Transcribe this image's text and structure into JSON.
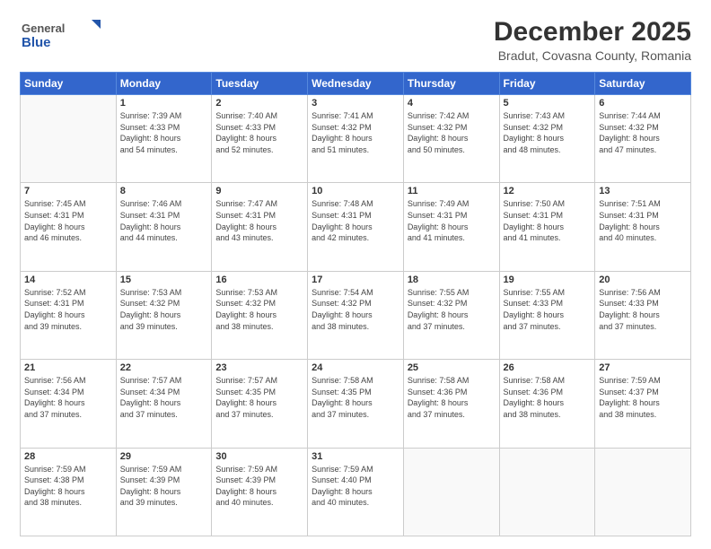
{
  "header": {
    "logo_general": "General",
    "logo_blue": "Blue",
    "title": "December 2025",
    "subtitle": "Bradut, Covasna County, Romania"
  },
  "weekdays": [
    "Sunday",
    "Monday",
    "Tuesday",
    "Wednesday",
    "Thursday",
    "Friday",
    "Saturday"
  ],
  "weeks": [
    [
      {
        "day": "",
        "info": ""
      },
      {
        "day": "1",
        "info": "Sunrise: 7:39 AM\nSunset: 4:33 PM\nDaylight: 8 hours\nand 54 minutes."
      },
      {
        "day": "2",
        "info": "Sunrise: 7:40 AM\nSunset: 4:33 PM\nDaylight: 8 hours\nand 52 minutes."
      },
      {
        "day": "3",
        "info": "Sunrise: 7:41 AM\nSunset: 4:32 PM\nDaylight: 8 hours\nand 51 minutes."
      },
      {
        "day": "4",
        "info": "Sunrise: 7:42 AM\nSunset: 4:32 PM\nDaylight: 8 hours\nand 50 minutes."
      },
      {
        "day": "5",
        "info": "Sunrise: 7:43 AM\nSunset: 4:32 PM\nDaylight: 8 hours\nand 48 minutes."
      },
      {
        "day": "6",
        "info": "Sunrise: 7:44 AM\nSunset: 4:32 PM\nDaylight: 8 hours\nand 47 minutes."
      }
    ],
    [
      {
        "day": "7",
        "info": "Sunrise: 7:45 AM\nSunset: 4:31 PM\nDaylight: 8 hours\nand 46 minutes."
      },
      {
        "day": "8",
        "info": "Sunrise: 7:46 AM\nSunset: 4:31 PM\nDaylight: 8 hours\nand 44 minutes."
      },
      {
        "day": "9",
        "info": "Sunrise: 7:47 AM\nSunset: 4:31 PM\nDaylight: 8 hours\nand 43 minutes."
      },
      {
        "day": "10",
        "info": "Sunrise: 7:48 AM\nSunset: 4:31 PM\nDaylight: 8 hours\nand 42 minutes."
      },
      {
        "day": "11",
        "info": "Sunrise: 7:49 AM\nSunset: 4:31 PM\nDaylight: 8 hours\nand 41 minutes."
      },
      {
        "day": "12",
        "info": "Sunrise: 7:50 AM\nSunset: 4:31 PM\nDaylight: 8 hours\nand 41 minutes."
      },
      {
        "day": "13",
        "info": "Sunrise: 7:51 AM\nSunset: 4:31 PM\nDaylight: 8 hours\nand 40 minutes."
      }
    ],
    [
      {
        "day": "14",
        "info": "Sunrise: 7:52 AM\nSunset: 4:31 PM\nDaylight: 8 hours\nand 39 minutes."
      },
      {
        "day": "15",
        "info": "Sunrise: 7:53 AM\nSunset: 4:32 PM\nDaylight: 8 hours\nand 39 minutes."
      },
      {
        "day": "16",
        "info": "Sunrise: 7:53 AM\nSunset: 4:32 PM\nDaylight: 8 hours\nand 38 minutes."
      },
      {
        "day": "17",
        "info": "Sunrise: 7:54 AM\nSunset: 4:32 PM\nDaylight: 8 hours\nand 38 minutes."
      },
      {
        "day": "18",
        "info": "Sunrise: 7:55 AM\nSunset: 4:32 PM\nDaylight: 8 hours\nand 37 minutes."
      },
      {
        "day": "19",
        "info": "Sunrise: 7:55 AM\nSunset: 4:33 PM\nDaylight: 8 hours\nand 37 minutes."
      },
      {
        "day": "20",
        "info": "Sunrise: 7:56 AM\nSunset: 4:33 PM\nDaylight: 8 hours\nand 37 minutes."
      }
    ],
    [
      {
        "day": "21",
        "info": "Sunrise: 7:56 AM\nSunset: 4:34 PM\nDaylight: 8 hours\nand 37 minutes."
      },
      {
        "day": "22",
        "info": "Sunrise: 7:57 AM\nSunset: 4:34 PM\nDaylight: 8 hours\nand 37 minutes."
      },
      {
        "day": "23",
        "info": "Sunrise: 7:57 AM\nSunset: 4:35 PM\nDaylight: 8 hours\nand 37 minutes."
      },
      {
        "day": "24",
        "info": "Sunrise: 7:58 AM\nSunset: 4:35 PM\nDaylight: 8 hours\nand 37 minutes."
      },
      {
        "day": "25",
        "info": "Sunrise: 7:58 AM\nSunset: 4:36 PM\nDaylight: 8 hours\nand 37 minutes."
      },
      {
        "day": "26",
        "info": "Sunrise: 7:58 AM\nSunset: 4:36 PM\nDaylight: 8 hours\nand 38 minutes."
      },
      {
        "day": "27",
        "info": "Sunrise: 7:59 AM\nSunset: 4:37 PM\nDaylight: 8 hours\nand 38 minutes."
      }
    ],
    [
      {
        "day": "28",
        "info": "Sunrise: 7:59 AM\nSunset: 4:38 PM\nDaylight: 8 hours\nand 38 minutes."
      },
      {
        "day": "29",
        "info": "Sunrise: 7:59 AM\nSunset: 4:39 PM\nDaylight: 8 hours\nand 39 minutes."
      },
      {
        "day": "30",
        "info": "Sunrise: 7:59 AM\nSunset: 4:39 PM\nDaylight: 8 hours\nand 40 minutes."
      },
      {
        "day": "31",
        "info": "Sunrise: 7:59 AM\nSunset: 4:40 PM\nDaylight: 8 hours\nand 40 minutes."
      },
      {
        "day": "",
        "info": ""
      },
      {
        "day": "",
        "info": ""
      },
      {
        "day": "",
        "info": ""
      }
    ]
  ]
}
